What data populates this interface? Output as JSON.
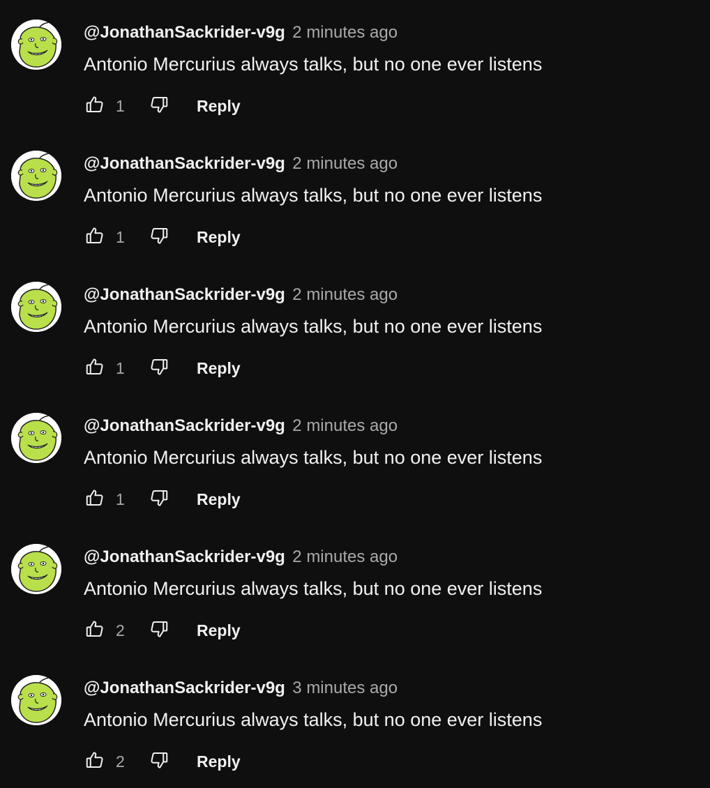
{
  "colors": {
    "background": "#0f0f0f",
    "primary_text": "#f1f1f1",
    "secondary_text": "#aaaaaa",
    "avatar_green": "#b9e04a"
  },
  "icons": {
    "like": "thumbs-up-outline",
    "dislike": "thumbs-down-outline",
    "avatar": "green-face-avatar"
  },
  "comments": [
    {
      "author": "@JonathanSackrider-v9g",
      "time": "2 minutes ago",
      "text": "Antonio Mercurius always talks, but no one ever listens",
      "likes": "1",
      "reply_label": "Reply"
    },
    {
      "author": "@JonathanSackrider-v9g",
      "time": "2 minutes ago",
      "text": "Antonio Mercurius always talks, but no one ever listens",
      "likes": "1",
      "reply_label": "Reply"
    },
    {
      "author": "@JonathanSackrider-v9g",
      "time": "2 minutes ago",
      "text": "Antonio Mercurius always talks, but no one ever listens",
      "likes": "1",
      "reply_label": "Reply"
    },
    {
      "author": "@JonathanSackrider-v9g",
      "time": "2 minutes ago",
      "text": "Antonio Mercurius always talks, but no one ever listens",
      "likes": "1",
      "reply_label": "Reply"
    },
    {
      "author": "@JonathanSackrider-v9g",
      "time": "2 minutes ago",
      "text": "Antonio Mercurius always talks, but no one ever listens",
      "likes": "2",
      "reply_label": "Reply"
    },
    {
      "author": "@JonathanSackrider-v9g",
      "time": "3 minutes ago",
      "text": "Antonio Mercurius always talks, but no one ever listens",
      "likes": "2",
      "reply_label": "Reply"
    }
  ]
}
